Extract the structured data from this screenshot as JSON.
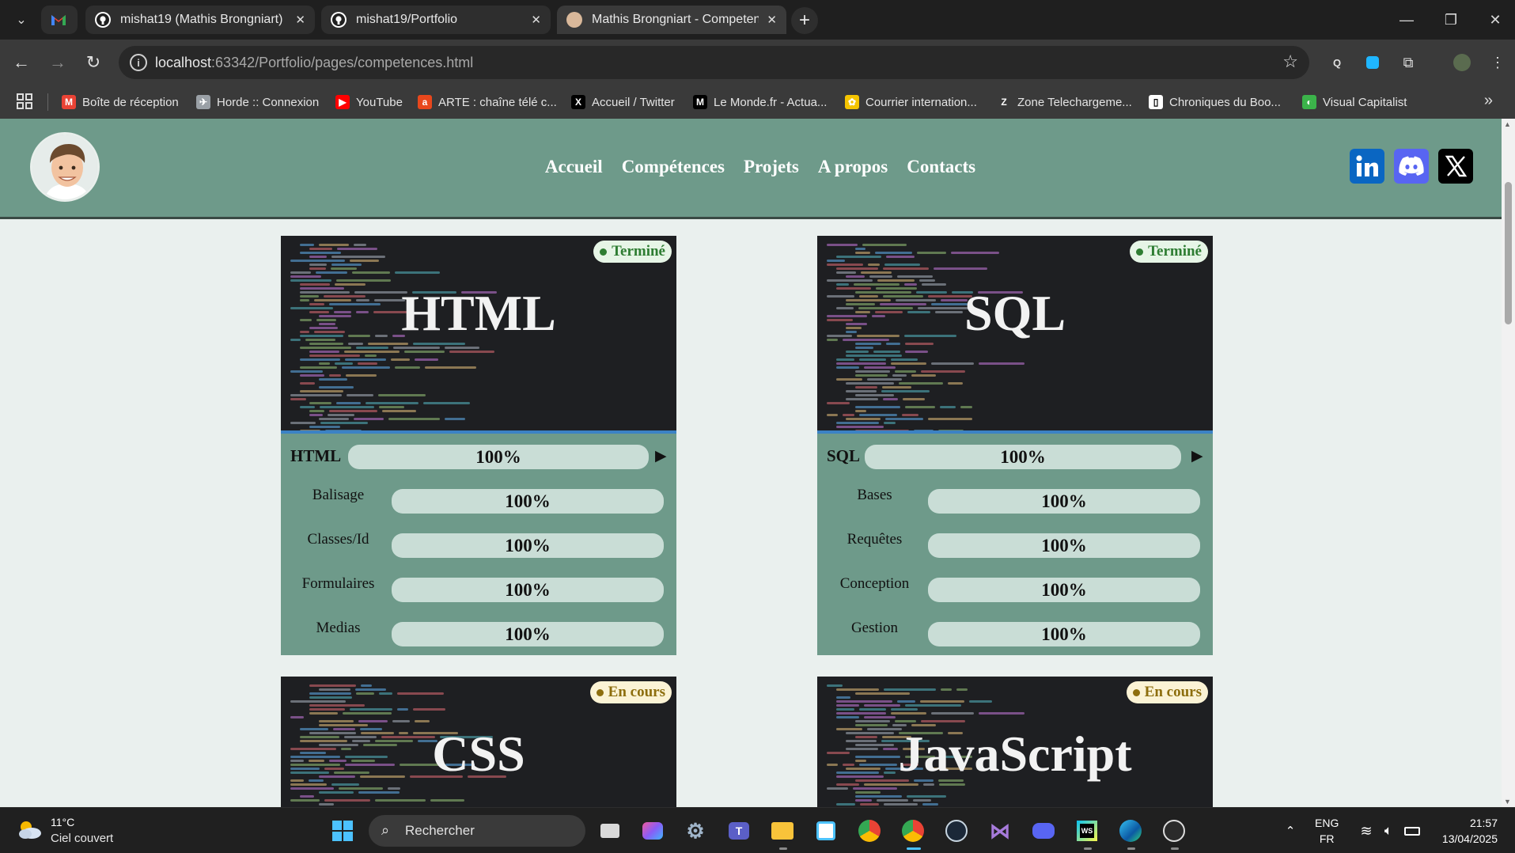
{
  "browser": {
    "tabs": [
      {
        "title": "",
        "icon": "gmail-icon"
      },
      {
        "title": "mishat19 (Mathis Brongniart)",
        "icon": "github-icon"
      },
      {
        "title": "mishat19/Portfolio",
        "icon": "github-icon"
      },
      {
        "title": "Mathis Brongniart - Competenc",
        "icon": "avatar-icon"
      }
    ],
    "address": {
      "host": "localhost",
      "rest": ":63342/Portfolio/pages/competences.html"
    },
    "bookmarks": [
      {
        "label": "Boîte de réception",
        "icon": "gmail-icon",
        "color": "#ea4335"
      },
      {
        "label": "Horde :: Connexion",
        "icon": "horde-icon",
        "color": "#9aa0a6"
      },
      {
        "label": "YouTube",
        "icon": "youtube-icon",
        "color": "#ff0000"
      },
      {
        "label": "ARTE : chaîne télé c...",
        "icon": "arte-icon",
        "color": "#e8471c"
      },
      {
        "label": "Accueil / Twitter",
        "icon": "x-icon",
        "color": "#000000"
      },
      {
        "label": "Le Monde.fr - Actua...",
        "icon": "lemonde-icon",
        "color": "#000000"
      },
      {
        "label": "Courrier internation...",
        "icon": "courrier-icon",
        "color": "#f5c400"
      },
      {
        "label": "Zone Telechargeme...",
        "icon": "zt-icon",
        "color": "#3a3a3a"
      },
      {
        "label": "Chroniques du Boo...",
        "icon": "chroniques-icon",
        "color": "#ffffff"
      },
      {
        "label": "Visual Capitalist",
        "icon": "visualcapitalist-icon",
        "color": "#3bb34a"
      }
    ]
  },
  "site": {
    "nav": [
      "Accueil",
      "Compétences",
      "Projets",
      "A propos",
      "Contacts"
    ],
    "social": [
      {
        "name": "linkedin",
        "color": "#0a66c2"
      },
      {
        "name": "discord",
        "color": "#5865f2"
      },
      {
        "name": "x",
        "color": "#000000"
      }
    ]
  },
  "cards": [
    {
      "language": "HTML",
      "status": "Terminé",
      "status_kind": "done",
      "main": {
        "name": "HTML",
        "value": "100%",
        "fraction": 1.0
      },
      "subs": [
        {
          "name": "Balisage",
          "value": "100%",
          "fraction": 1.0
        },
        {
          "name": "Classes/Id",
          "value": "100%",
          "fraction": 1.0
        },
        {
          "name": "Formulaires",
          "value": "100%",
          "fraction": 1.0
        },
        {
          "name": "Medias",
          "value": "100%",
          "fraction": 1.0
        }
      ]
    },
    {
      "language": "SQL",
      "status": "Terminé",
      "status_kind": "done",
      "main": {
        "name": "SQL",
        "value": "100%",
        "fraction": 1.0
      },
      "subs": [
        {
          "name": "Bases",
          "value": "100%",
          "fraction": 1.0
        },
        {
          "name": "Requêtes",
          "value": "100%",
          "fraction": 1.0
        },
        {
          "name": "Conception",
          "value": "100%",
          "fraction": 1.0
        },
        {
          "name": "Gestion",
          "value": "100%",
          "fraction": 1.0
        }
      ]
    },
    {
      "language": "CSS",
      "status": "En cours",
      "status_kind": "wip"
    },
    {
      "language": "JavaScript",
      "status": "En cours",
      "status_kind": "wip"
    }
  ],
  "taskbar": {
    "weather": {
      "temp": "11°C",
      "desc": "Ciel couvert"
    },
    "search_placeholder": "Rechercher",
    "lang": {
      "line1": "ENG",
      "line2": "FR"
    },
    "clock": {
      "time": "21:57",
      "date": "13/04/2025"
    }
  }
}
